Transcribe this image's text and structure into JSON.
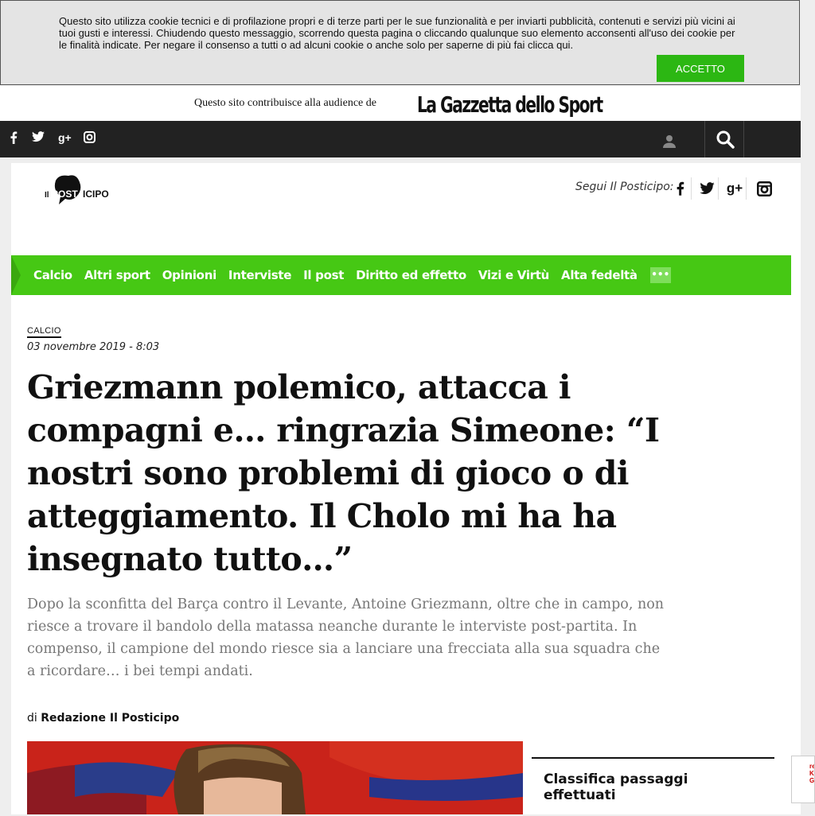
{
  "cookie_banner": {
    "text": "Questo sito utilizza cookie tecnici e di profilazione propri e di terze parti per le sue funzionalità e per inviarti pubblicità, contenuti e servizi più vicini ai tuoi gusti e interessi. Chiudendo questo messaggio, scorrendo questa pagina o cliccando qualunque suo elemento acconsenti all'uso dei cookie per le finalità indicate. Per negare il consenso a tutti o ad alcuni cookie o anche solo per saperne di più fai clicca qui.",
    "accept_label": "ACCETTO",
    "accent": "#2cb713"
  },
  "audience": {
    "text": "Questo sito contribuisce alla audience de",
    "brand": "La Gazzetta dello Sport"
  },
  "top_bar": {
    "social_icons": [
      "facebook-icon",
      "twitter-icon",
      "google-plus-icon",
      "instagram-icon"
    ],
    "facebook": "f",
    "twitter": "t",
    "google_plus": "g+",
    "instagram": "◎"
  },
  "header": {
    "logo_text_1": "Il",
    "logo_text_2": "POSTICIPO",
    "follow_label": "Segui Il Posticipo:",
    "social": {
      "facebook": "f",
      "twitter": "t",
      "google_plus": "g+",
      "instagram": "◎"
    }
  },
  "nav": {
    "items": [
      "Calcio",
      "Altri sport",
      "Opinioni",
      "Interviste",
      "Il post",
      "Diritto ed effetto",
      "Vizi e Virtù",
      "Alta fedeltà"
    ],
    "more": "•••",
    "color": "#46c814"
  },
  "article": {
    "category": "CALCIO",
    "date": "03 novembre 2019 - 8:03",
    "title": "Griezmann polemico, attacca i compagni e… ringrazia Simeone: “I nostri sono problemi di gioco o di atteggiamento. Il Cholo mi ha ha insegnato tutto…”",
    "summary": "Dopo la sconfitta del Barça contro il Levante, Antoine Griezmann, oltre che in campo, non riesce a trovare il bandolo della matassa neanche durante le interviste post-partita. In compenso, il campione del mondo riesce sia a lanciare una frecciata alla sua squadra che a ricordare… i bei tempi andati.",
    "by_prefix": "di",
    "author": "Redazione Il Posticipo"
  },
  "sidebar_box": {
    "title": "Classifica passaggi effettuati"
  }
}
